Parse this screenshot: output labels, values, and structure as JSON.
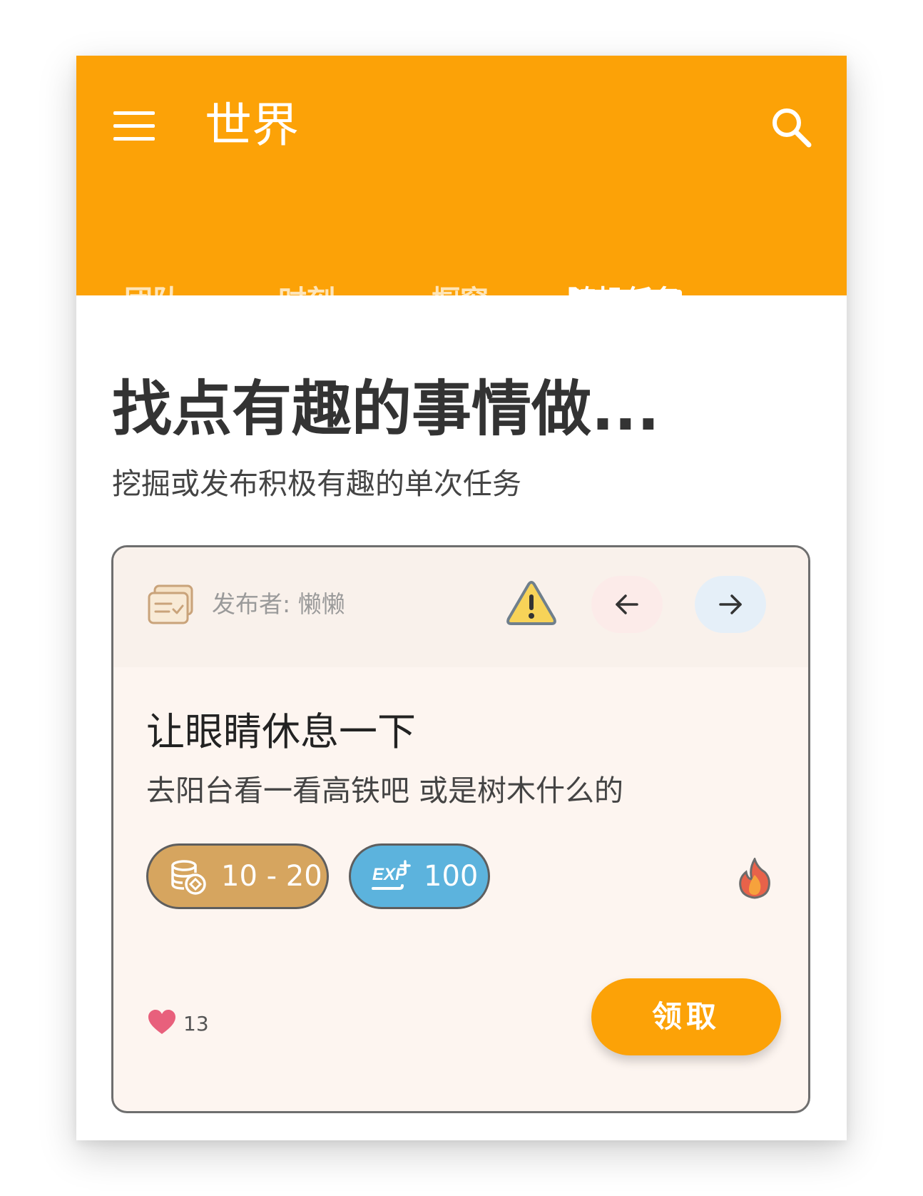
{
  "app_bar": {
    "title": "世界",
    "menu_icon": "menu-icon",
    "search_icon": "search-icon"
  },
  "tabs": [
    {
      "label": "团队",
      "active": false
    },
    {
      "label": "时刻",
      "active": false
    },
    {
      "label": "橱窗",
      "active": false
    },
    {
      "label": "随机任务",
      "active": true
    }
  ],
  "page": {
    "headline": "找点有趣的事情做...",
    "subhead": "挖掘或发布积极有趣的单次任务"
  },
  "task_card": {
    "publisher": "发布者: 懒懒",
    "title": "让眼睛休息一下",
    "description": "去阳台看一看高铁吧 或是树木什么的",
    "coin_reward": "10 - 20",
    "exp_reward": "100",
    "likes": "13",
    "claim_label": "领取"
  },
  "colors": {
    "accent": "#fca207",
    "coin_pill": "#d6a55f",
    "exp_pill": "#5cb3dd",
    "card_bg": "#fdf5f0",
    "heart": "#e8607c"
  }
}
